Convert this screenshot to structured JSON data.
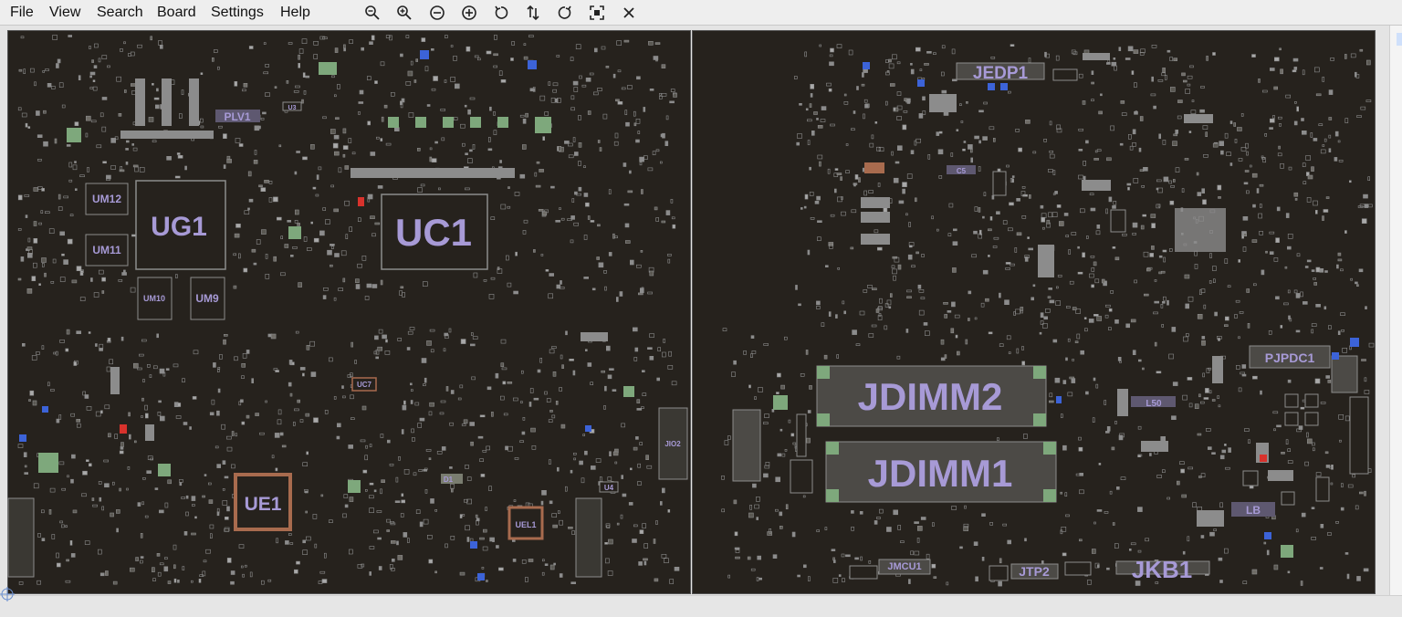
{
  "menu": {
    "file": "File",
    "view": "View",
    "search": "Search",
    "board": "Board",
    "settings": "Settings",
    "help": "Help"
  },
  "toolbar": [
    {
      "name": "zoom-out-magnifier-icon"
    },
    {
      "name": "zoom-in-magnifier-icon"
    },
    {
      "name": "zoom-out-circle-icon"
    },
    {
      "name": "zoom-in-circle-icon"
    },
    {
      "name": "rotate-left-icon"
    },
    {
      "name": "flip-vertical-icon"
    },
    {
      "name": "rotate-right-icon"
    },
    {
      "name": "fit-view-icon"
    },
    {
      "name": "close-icon"
    }
  ],
  "boards": {
    "left_labels": {
      "ug1": "UG1",
      "uc1": "UC1",
      "um12": "UM12",
      "um11": "UM11",
      "um10": "UM10",
      "um9": "UM9",
      "ue1": "UE1",
      "uel1": "UEL1",
      "uc7": "UC7",
      "u3": "U3",
      "u4": "U4",
      "jio2": "JIO2",
      "plv1": "PLV1",
      "d1": "D1"
    },
    "right_labels": {
      "jedp1": "JEDP1",
      "jdimm2": "JDIMM2",
      "jdimm1": "JDIMM1",
      "pjpdc1": "PJPDC1",
      "jmcu1": "JMCU1",
      "jtp2": "JTP2",
      "jkb1": "JKB1",
      "l50": "L50",
      "lb": "LB",
      "c5": "C5"
    }
  },
  "colors": {
    "board_bg": "#26221d",
    "label": "#a79ad6",
    "pad": "#8c8c8c",
    "component_body": "#807a70",
    "accent_blue": "#3c63d8",
    "accent_red": "#d8322c",
    "copper": "#a86b4e",
    "green_pad": "#7ea87c"
  }
}
